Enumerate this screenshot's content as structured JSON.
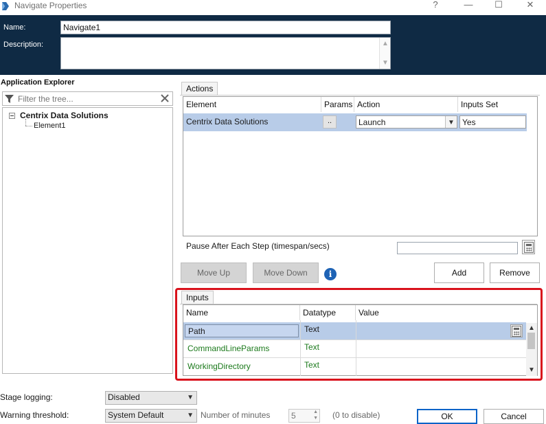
{
  "window": {
    "title": "Navigate Properties",
    "controls": {
      "help": "?",
      "minimize": "—",
      "maximize": "☐",
      "close": "✕"
    }
  },
  "header": {
    "name_label": "Name:",
    "name_value": "Navigate1",
    "description_label": "Description:",
    "description_value": ""
  },
  "explorer": {
    "title": "Application Explorer",
    "filter_placeholder": "Filter the tree...",
    "tree": {
      "root": "Centrix Data Solutions",
      "child": "Element1"
    }
  },
  "actions": {
    "tab": "Actions",
    "columns": {
      "element": "Element",
      "params": "Params",
      "action": "Action",
      "inputs_set": "Inputs Set"
    },
    "rows": [
      {
        "element": "Centrix Data Solutions",
        "params": "..",
        "action": "Launch",
        "inputs_set": "Yes"
      }
    ],
    "pause_label": "Pause After Each Step (timespan/secs)",
    "pause_value": "",
    "buttons": {
      "move_up": "Move Up",
      "move_down": "Move Down",
      "add": "Add",
      "remove": "Remove"
    }
  },
  "inputs": {
    "tab": "Inputs",
    "columns": {
      "name": "Name",
      "datatype": "Datatype",
      "value": "Value"
    },
    "rows": [
      {
        "name": "Path",
        "datatype": "Text",
        "value": ""
      },
      {
        "name": "CommandLineParams",
        "datatype": "Text",
        "value": ""
      },
      {
        "name": "WorkingDirectory",
        "datatype": "Text",
        "value": ""
      }
    ]
  },
  "footer": {
    "stage_logging_label": "Stage logging:",
    "stage_logging_value": "Disabled",
    "warning_label": "Warning threshold:",
    "warning_value": "System Default",
    "minutes_label": "Number of minutes",
    "minutes_value": "5",
    "disable_hint": "(0 to disable)",
    "ok": "OK",
    "cancel": "Cancel"
  },
  "colors": {
    "header_bg": "#0f2a44",
    "selection": "#b8cce8",
    "highlight_frame": "#d9121c",
    "param_name_green": "#1c7a1c",
    "info_blue": "#1e63b5"
  }
}
